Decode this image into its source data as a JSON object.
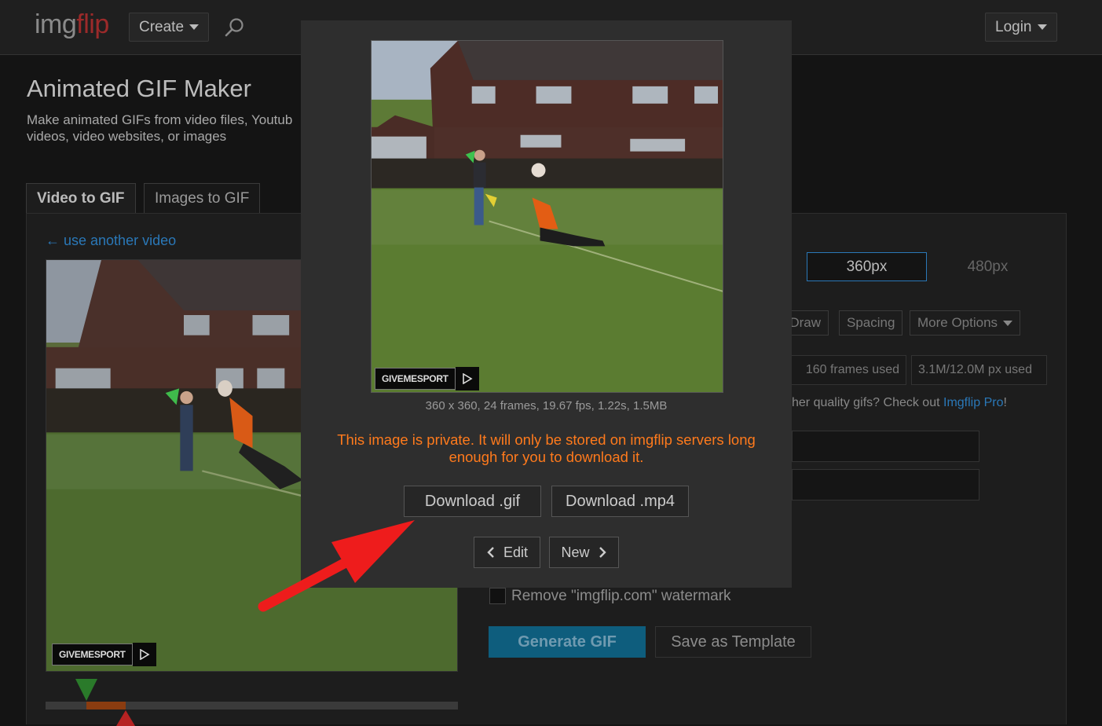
{
  "nav": {
    "logo_part1": "img",
    "logo_part2": "flip",
    "create_label": "Create",
    "login_label": "Login"
  },
  "page": {
    "title": "Animated GIF Maker",
    "subtitle": "Make animated GIFs from video files, Youtub\nvideos, video websites, or images",
    "tabs": [
      {
        "label": "Video to GIF"
      },
      {
        "label": "Images to GIF"
      }
    ],
    "back_link": "← use another video"
  },
  "options": {
    "sizes": [
      {
        "label": "360px"
      },
      {
        "label": "480px"
      }
    ],
    "buttons": [
      {
        "label": "Draw"
      },
      {
        "label": "Spacing"
      },
      {
        "label": "More Options"
      }
    ],
    "frames_used": "160 frames used",
    "px_used": "3.1M/12.0M px used",
    "pro_text": "her quality gifs? Check out ",
    "pro_link": "Imgflip Pro",
    "pro_end": "!",
    "watermark_label": "Remove \"imgflip.com\" watermark",
    "generate_label": "Generate GIF",
    "template_label": "Save as Template"
  },
  "modal": {
    "image_info": "360 x 360, 24 frames, 19.67 fps, 1.22s, 1.5MB",
    "private_message": "This image is private. It will only be stored on imgflip servers long\nenough for you to download it.",
    "download_gif": "Download .gif",
    "download_mp4": "Download .mp4",
    "edit_label": "Edit",
    "new_label": "New"
  },
  "watermark_text": "GIVEMESPORT",
  "colors": {
    "accent_link": "#2a78b8",
    "warning": "#ff7a1c",
    "generate_button": "#0e5d7d",
    "arrow": "#ee1c1c"
  }
}
